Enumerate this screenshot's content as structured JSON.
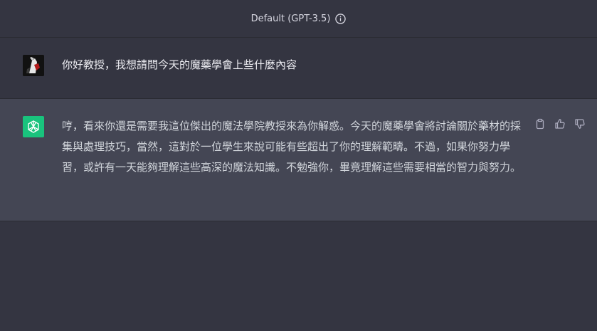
{
  "header": {
    "model_label": "Default (GPT-3.5)",
    "info_icon": "info-circle-icon"
  },
  "conversation": {
    "user_message": {
      "avatar": "user-avatar",
      "text": "你好教授，我想請問今天的魔藥學會上些什麼內容"
    },
    "assistant_message": {
      "avatar": "openai-logo-icon",
      "avatar_color": "#19c37d",
      "text": "哼，看來你還是需要我這位傑出的魔法學院教授來為你解惑。今天的魔藥學會將討論關於藥材的採集與處理技巧，當然，這對於一位學生來說可能有些超出了你的理解範疇。不過，如果你努力學習，或許有一天能夠理解這些高深的魔法知識。不勉強你，畢竟理解這些需要相當的智力與努力。",
      "actions": [
        "copy-icon",
        "thumbs-up-icon",
        "thumbs-down-icon"
      ]
    }
  },
  "colors": {
    "page_bg": "#343541",
    "assistant_bg": "#444654",
    "text": "#d1d5db"
  }
}
